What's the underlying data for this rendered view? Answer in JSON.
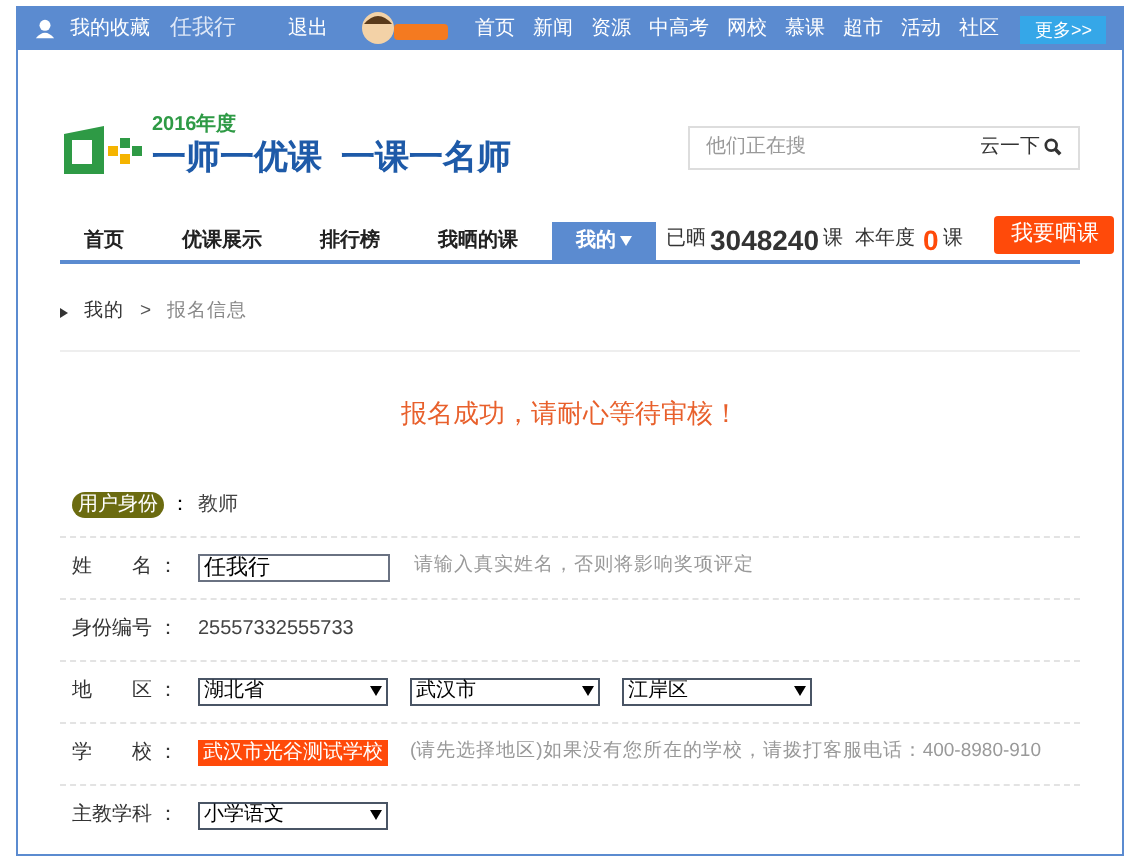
{
  "top_bar": {
    "favorites": "我的收藏",
    "username": "任我行",
    "logout": "退出",
    "links": [
      "首页",
      "新闻",
      "资源",
      "中高考",
      "网校",
      "慕课",
      "超市",
      "活动",
      "社区"
    ],
    "more": "更多>>"
  },
  "header": {
    "logo_year": "2016年度",
    "logo_text": "一师一优课  一课一名师",
    "search": {
      "placeholder": "他们正在搜",
      "button": "云一下"
    }
  },
  "tabs": [
    {
      "label": "首页",
      "selected": false
    },
    {
      "label": "优课展示",
      "selected": false
    },
    {
      "label": "排行榜",
      "selected": false
    },
    {
      "label": "我晒的课",
      "selected": false
    },
    {
      "label": "我的",
      "selected": true
    }
  ],
  "stats": {
    "label_total": "已晒",
    "total": "3048240",
    "unit_total": "课",
    "label_year": "本年度",
    "year": "0",
    "unit_year": "课",
    "button": "我要晒课"
  },
  "breadcrumb": {
    "parent": "我的",
    "separator": ">",
    "current": "报名信息"
  },
  "message": "报名成功，请耐心等待审核！",
  "form": [
    {
      "kind": "badge",
      "label": "用户身份",
      "colon": "：",
      "value": "教师"
    },
    {
      "kind": "input",
      "label": "姓　　名",
      "colon": "：",
      "value": "任我行",
      "hint": "请输入真实姓名，否则将影响奖项评定"
    },
    {
      "kind": "text",
      "label": "身份编号",
      "colon": "：",
      "value": "25557332555733"
    },
    {
      "kind": "selects",
      "label": "地　　区",
      "colon": "：",
      "options": [
        "湖北省",
        "武汉市",
        "江岸区"
      ]
    },
    {
      "kind": "school",
      "label": "学　　校",
      "colon": "：",
      "value": "武汉市光谷测试学校",
      "hint": "(请先选择地区)如果没有您所在的学校，请拨打客服电话：400-8980-910"
    },
    {
      "kind": "selects",
      "label": "主教学科",
      "colon": "：",
      "options": [
        "小学语文"
      ]
    }
  ]
}
